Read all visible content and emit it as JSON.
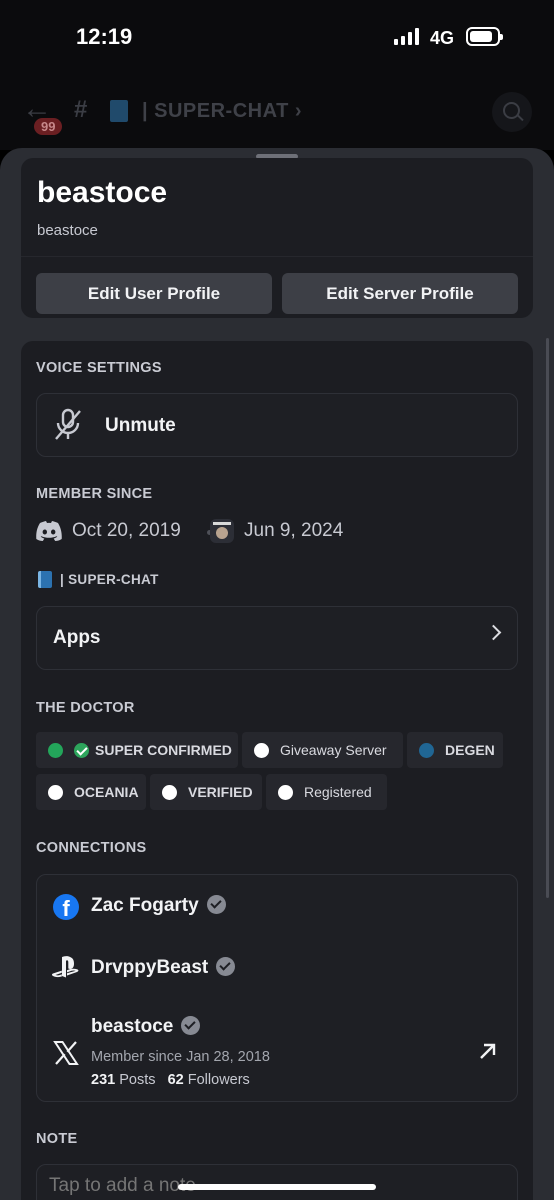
{
  "status_bar": {
    "time": "12:19",
    "network": "4G"
  },
  "channel_header": {
    "badge": "99",
    "name": "| SUPER-CHAT ›"
  },
  "profile": {
    "display_name": "beastoce",
    "username": "beastoce",
    "edit_user_label": "Edit User Profile",
    "edit_server_label": "Edit Server Profile"
  },
  "voice": {
    "title": "VOICE SETTINGS",
    "unmute_label": "Unmute"
  },
  "member_since": {
    "title": "MEMBER SINCE",
    "discord_date": "Oct 20, 2019",
    "server_date": "Jun 9, 2024",
    "channel_label": "| SUPER-CHAT"
  },
  "apps": {
    "label": "Apps"
  },
  "roles": {
    "title": "THE DOCTOR",
    "items": [
      {
        "label": "SUPER CONFIRMED",
        "color": "#23a55a",
        "check": true
      },
      {
        "label": "Giveaway Server",
        "color": "#ffffff"
      },
      {
        "label": "DEGEN",
        "color": "#206694"
      },
      {
        "label": "OCEANIA",
        "color": "#ffffff"
      },
      {
        "label": "VERIFIED",
        "color": "#ffffff"
      },
      {
        "label": "Registered",
        "color": "#ffffff"
      }
    ]
  },
  "connections": {
    "title": "CONNECTIONS",
    "facebook": {
      "name": "Zac Fogarty",
      "icon": "facebook-icon"
    },
    "playstation": {
      "name": "DrvppyBeast",
      "icon": "playstation-icon"
    },
    "x": {
      "name": "beastoce",
      "icon": "x-icon",
      "member_since": "Member since Jan 28, 2018",
      "posts_count": "231",
      "posts_label": "Posts",
      "followers_count": "62",
      "followers_label": "Followers"
    }
  },
  "note": {
    "title": "NOTE",
    "placeholder": "Tap to add a note"
  }
}
